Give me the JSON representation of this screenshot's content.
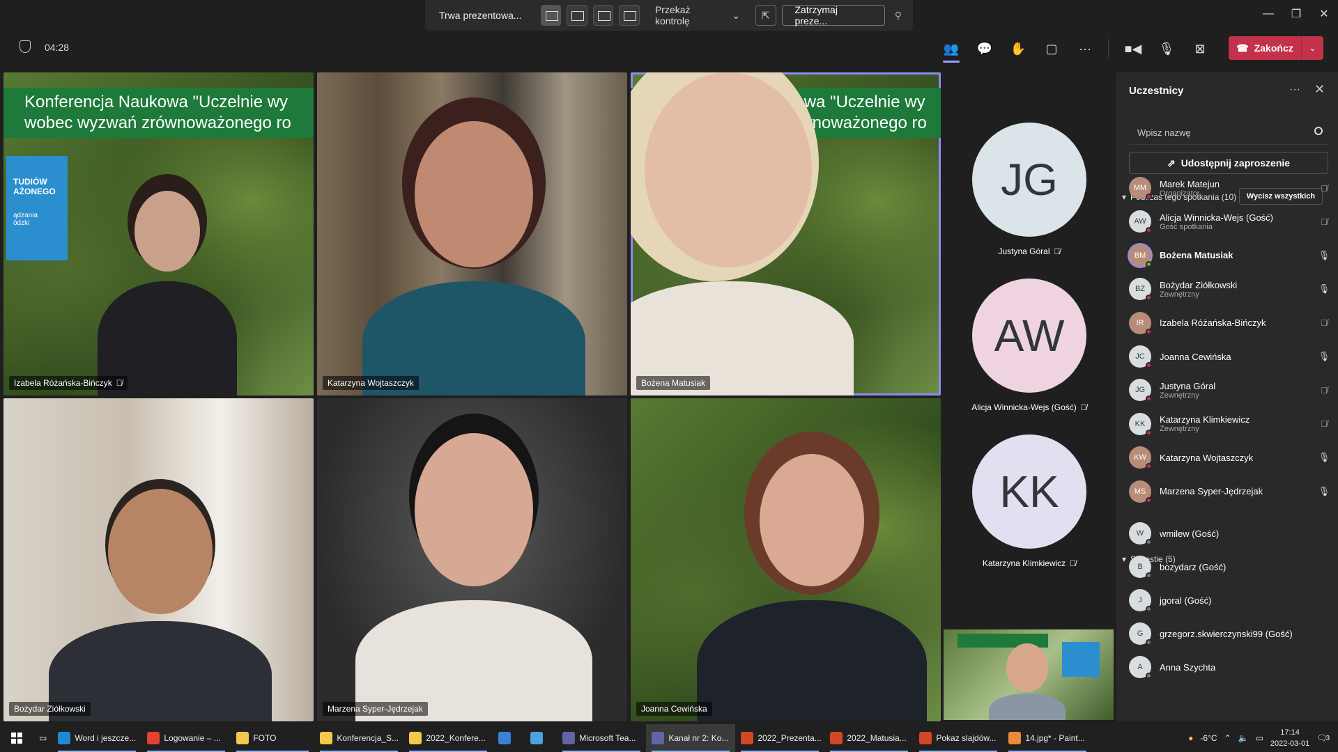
{
  "window": {
    "minimize": "—",
    "restore": "❐",
    "close": "✕"
  },
  "presenting_bar": {
    "status": "Trwa prezentowa...",
    "give_control": "Przekaż kontrolę",
    "stop": "Zatrzymaj preze..."
  },
  "meeting": {
    "timer": "04:28",
    "end_label": "Zakończ"
  },
  "video_tiles": [
    {
      "name": "Izabela Różańska-Bińczyk",
      "muted": true
    },
    {
      "name": "Katarzyna Wojtaszczyk",
      "muted": false
    },
    {
      "name": "Bożena Matusiak",
      "muted": false,
      "speaking": true
    },
    {
      "name": "Bożydar Ziółkowski",
      "muted": false
    },
    {
      "name": "Marzena Syper-Jędrzejak",
      "muted": false
    },
    {
      "name": "Joanna Cewińska",
      "muted": false
    }
  ],
  "banner": {
    "tile1_line1": "Konferencja Naukowa \"Uczelnie wy",
    "tile1_line2": "wobec wyzwań zrównoważonego ro",
    "tile3_line1": "ukowa \"Uczelnie wy",
    "tile3_line2": "zrównoważonego ro",
    "blue_line1": "TUDIÓW",
    "blue_line2": "AŻONEGO",
    "blue_line3": "ądzania",
    "blue_line4": "ódzki"
  },
  "avatar_tiles": [
    {
      "initials": "JG",
      "name": "Justyna Góral",
      "color": "#dbe4e8",
      "muted": true
    },
    {
      "initials": "AW",
      "name": "Alicja Winnicka-Wejs (Gość)",
      "color": "#f0d3e1",
      "muted": true
    },
    {
      "initials": "KK",
      "name": "Katarzyna Klimkiewicz",
      "color": "#e2dff0",
      "muted": true
    }
  ],
  "panel": {
    "title": "Uczestnicy",
    "search_placeholder": "Wpisz nazwę",
    "invite": "Udostępnij zaproszenie",
    "in_meeting_header": "Podczas tego spotkania (10)",
    "mute_all": "Wycisz wszystkich",
    "suggestions_header": "Sugestie (5)",
    "participants": [
      {
        "initials": "MM",
        "name": "Marek Matejun",
        "role": "Organizator",
        "muted": true,
        "photo": true
      },
      {
        "initials": "AW",
        "name": "Alicja Winnicka-Wejs (Gość)",
        "role": "Gość spotkania",
        "muted": true,
        "photo": false
      },
      {
        "initials": "BM",
        "name": "Bożena Matusiak",
        "role": "",
        "muted": false,
        "photo": true,
        "bold": true
      },
      {
        "initials": "BZ",
        "name": "Bożydar Ziółkowski",
        "role": "Zewnętrzny",
        "muted": false,
        "photo": false
      },
      {
        "initials": "IR",
        "name": "Izabela Różańska-Bińczyk",
        "role": "",
        "muted": true,
        "photo": true
      },
      {
        "initials": "JC",
        "name": "Joanna Cewińska",
        "role": "",
        "muted": false,
        "photo": false
      },
      {
        "initials": "JG",
        "name": "Justyna Góral",
        "role": "Zewnętrzny",
        "muted": true,
        "photo": false
      },
      {
        "initials": "KK",
        "name": "Katarzyna Klimkiewicz",
        "role": "Zewnętrzny",
        "muted": true,
        "photo": false
      },
      {
        "initials": "KW",
        "name": "Katarzyna Wojtaszczyk",
        "role": "",
        "muted": false,
        "photo": true
      },
      {
        "initials": "MS",
        "name": "Marzena Syper-Jędrzejak",
        "role": "",
        "muted": false,
        "photo": true
      }
    ],
    "suggestions": [
      {
        "initials": "W",
        "name": "wmilew (Gość)"
      },
      {
        "initials": "B",
        "name": "bozydarz (Gość)"
      },
      {
        "initials": "J",
        "name": "jgoral (Gość)"
      },
      {
        "initials": "G",
        "name": "grzegorz.skwierczynski99 (Gość)"
      },
      {
        "initials": "A",
        "name": "Anna Szychta"
      }
    ]
  },
  "taskbar": {
    "items": [
      {
        "label": "Word i jeszcze...",
        "color": "#1f8ad2"
      },
      {
        "label": "Logowanie – ...",
        "color": "#e34133"
      },
      {
        "label": "FOTO",
        "color": "#f2c94c"
      },
      {
        "label": "Konferencja_S...",
        "color": "#f2c94c"
      },
      {
        "label": "2022_Konfere...",
        "color": "#f2c94c"
      },
      {
        "label": "",
        "color": "#3b82d6"
      },
      {
        "label": "",
        "color": "#4aa3df"
      },
      {
        "label": "Microsoft Tea...",
        "color": "#6264a7"
      },
      {
        "label": "Kanał nr 2: Ko...",
        "color": "#6264a7"
      },
      {
        "label": "2022_Prezenta...",
        "color": "#d24726"
      },
      {
        "label": "2022_Matusia...",
        "color": "#d24726"
      },
      {
        "label": "Pokaz slajdów...",
        "color": "#d24726"
      },
      {
        "label": "14.jpg* - Paint...",
        "color": "#e88b3a"
      }
    ],
    "weather": "-6°C",
    "time": "17:14",
    "date": "2022-03-01",
    "notifications": "3"
  }
}
